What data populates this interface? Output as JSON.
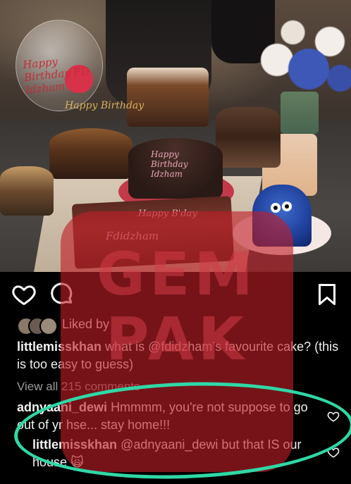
{
  "photo": {
    "balloon_text": "Happy Birthday FD Idzham",
    "topper_text": "Happy Birthday",
    "cake_plaque": "Happy Birthday Idzham",
    "cake_name": "Fdidzham",
    "cake_greeting": "Happy B'day"
  },
  "watermark": {
    "line1": "GEM",
    "line2": "PAK"
  },
  "actions": {
    "like": "heart-outline-icon",
    "comment": "comment-bubble-icon",
    "save": "bookmark-icon"
  },
  "likes": {
    "text": "Liked by"
  },
  "caption": {
    "username": "littlemisskhan",
    "text": "what is @fdidzham’s favourite cake? (this is too easy to guess)"
  },
  "view_all": "View all 215 comments",
  "comments": [
    {
      "username": "adnyaani_dewi",
      "text": "Hmmmm, you're not suppose to go out of yr hse... stay home!!!"
    },
    {
      "username": "littlemisskhan",
      "text": "@adnyaani_dewi but that IS our house 🙀"
    }
  ],
  "colors": {
    "background": "#000000",
    "text": "#f2f2f2",
    "muted": "#9a9a9a",
    "highlight_oval": "#2fd8a6",
    "watermark": "#be1e28"
  }
}
